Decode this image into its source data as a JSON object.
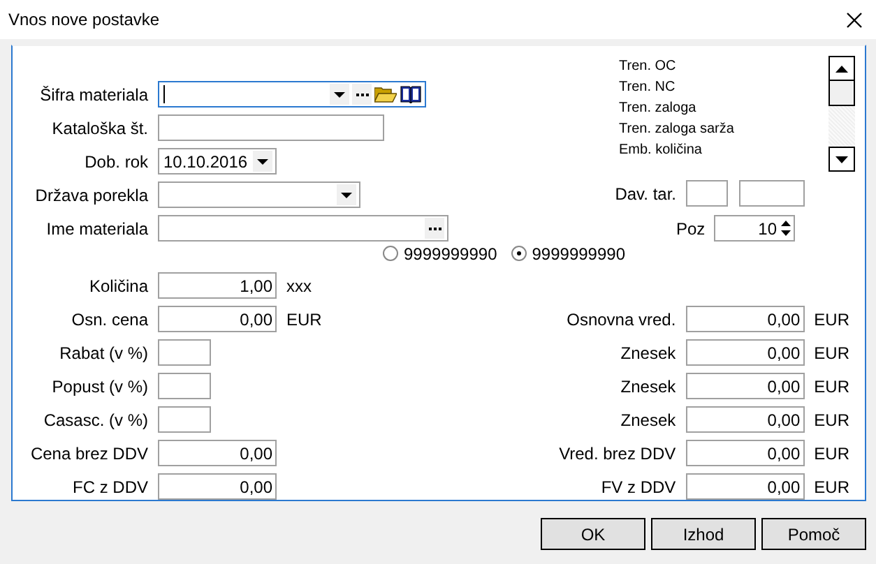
{
  "window": {
    "title": "Vnos nove postavke"
  },
  "material_fields": [
    {
      "kind": "code",
      "label": "Šifra materiala",
      "focused": true
    },
    {
      "kind": "text",
      "label": "Kataloška št."
    },
    {
      "kind": "date",
      "label": "Dob. rok",
      "value": "10.10.2016"
    },
    {
      "kind": "select",
      "label": "Država porekla"
    },
    {
      "kind": "lookup",
      "label": "Ime materiala"
    }
  ],
  "info_list": [
    "Tren. OC",
    "Tren. NC",
    "Tren. zaloga",
    "Tren. zaloga sarža",
    "Emb. količina"
  ],
  "dav_tar": {
    "label": "Dav. tar."
  },
  "poz": {
    "label": "Poz",
    "value": "10"
  },
  "radio_options": [
    {
      "label": "9999999990",
      "selected": false
    },
    {
      "label": "9999999990",
      "selected": true
    }
  ],
  "rows": [
    {
      "left": {
        "label": "Količina",
        "value": "1,00",
        "unit": "xxx",
        "kind": "wide"
      }
    },
    {
      "left": {
        "label": "Osn. cena",
        "value": "0,00",
        "unit": "EUR",
        "kind": "wide"
      },
      "right": {
        "label": "Osnovna vred.",
        "value": "0,00",
        "unit": "EUR"
      }
    },
    {
      "left": {
        "label": "Rabat (v %)",
        "kind": "narrow"
      },
      "right": {
        "label": "Znesek",
        "value": "0,00",
        "unit": "EUR"
      }
    },
    {
      "left": {
        "label": "Popust (v %)",
        "kind": "narrow"
      },
      "right": {
        "label": "Znesek",
        "value": "0,00",
        "unit": "EUR"
      }
    },
    {
      "left": {
        "label": "Casasc. (v %)",
        "kind": "narrow"
      },
      "right": {
        "label": "Znesek",
        "value": "0,00",
        "unit": "EUR"
      }
    },
    {
      "left": {
        "label": "Cena brez DDV",
        "value": "0,00",
        "kind": "wide"
      },
      "right": {
        "label": "Vred. brez DDV",
        "value": "0,00",
        "unit": "EUR"
      }
    },
    {
      "left": {
        "label": "FC z DDV",
        "value": "0,00",
        "kind": "wide"
      },
      "right": {
        "label": "FV z DDV",
        "value": "0,00",
        "unit": "EUR"
      }
    }
  ],
  "buttons": [
    "OK",
    "Izhod",
    "Pomoč"
  ]
}
